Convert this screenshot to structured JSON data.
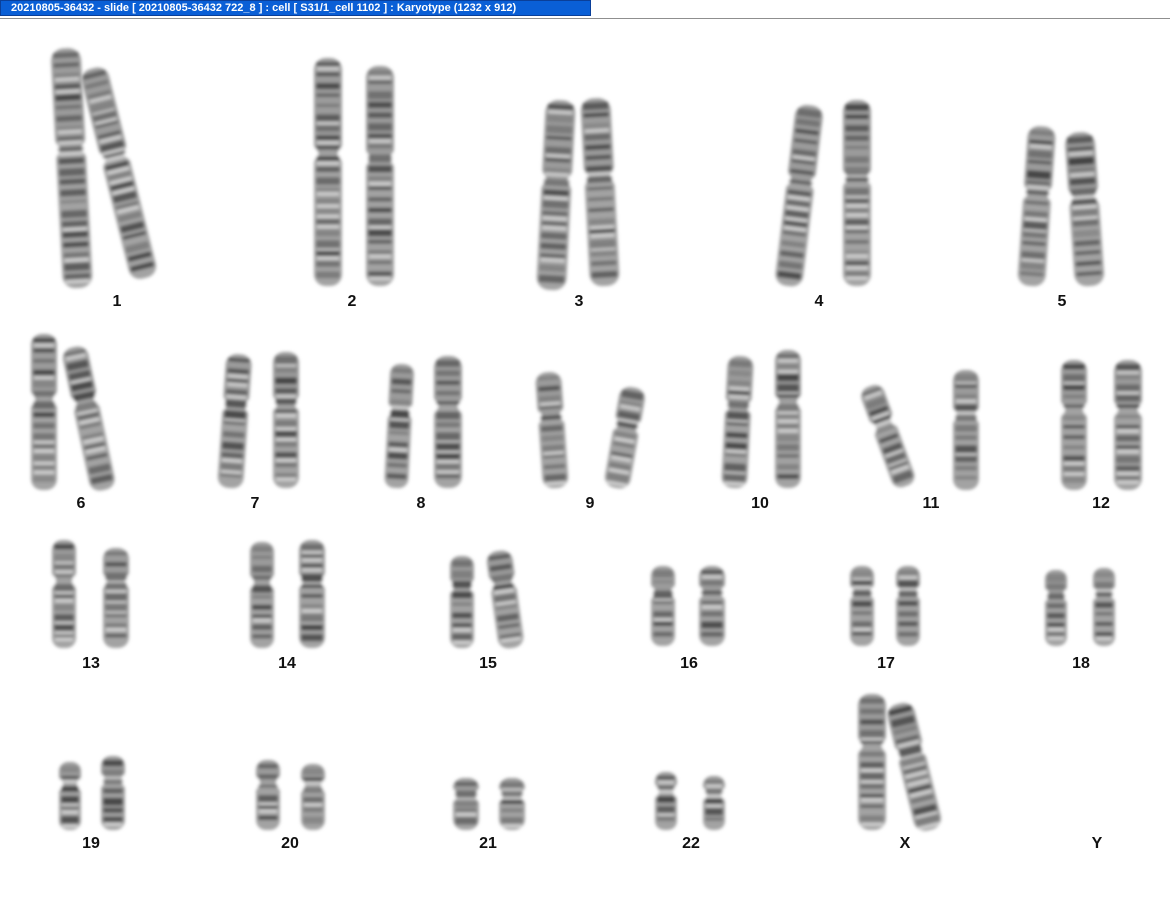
{
  "window": {
    "title": "20210805-36432 - slide [ 20210805-36432 722_8 ] : cell [ S31/1_cell 1102 ] : Karyotype  (1232 x 912)",
    "accent": "#0a5fd6"
  },
  "karyotype": {
    "chromosomes": [
      {
        "label": "1"
      },
      {
        "label": "2"
      },
      {
        "label": "3"
      },
      {
        "label": "4"
      },
      {
        "label": "5"
      },
      {
        "label": "6"
      },
      {
        "label": "7"
      },
      {
        "label": "8"
      },
      {
        "label": "9"
      },
      {
        "label": "10"
      },
      {
        "label": "11"
      },
      {
        "label": "12"
      },
      {
        "label": "13"
      },
      {
        "label": "14"
      },
      {
        "label": "15"
      },
      {
        "label": "16"
      },
      {
        "label": "17"
      },
      {
        "label": "18"
      },
      {
        "label": "19"
      },
      {
        "label": "20"
      },
      {
        "label": "21"
      },
      {
        "label": "22"
      },
      {
        "label": "X"
      },
      {
        "label": "Y"
      }
    ]
  }
}
